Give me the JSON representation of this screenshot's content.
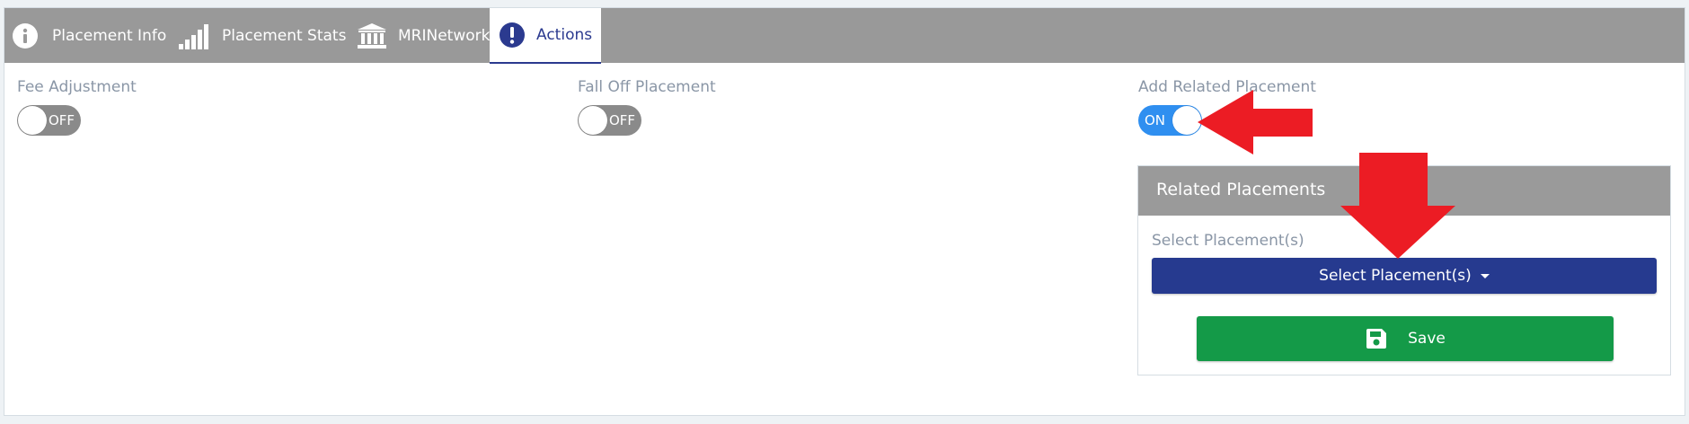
{
  "tabs": [
    {
      "label": "Placement Info",
      "icon": "info-circle-icon",
      "active": false
    },
    {
      "label": "Placement Stats",
      "icon": "signal-bars-icon",
      "active": false
    },
    {
      "label": "MRINetwork",
      "icon": "bank-building-icon",
      "active": false
    },
    {
      "label": "Actions",
      "icon": "exclamation-circle-icon",
      "active": true
    }
  ],
  "fields": {
    "fee_adjustment": {
      "label": "Fee Adjustment",
      "toggle": "OFF"
    },
    "fall_off_placement": {
      "label": "Fall Off Placement",
      "toggle": "OFF"
    },
    "add_related_placement": {
      "label": "Add Related Placement",
      "toggle": "ON"
    }
  },
  "related_placements": {
    "title": "Related Placements",
    "select_label": "Select Placement(s)",
    "select_button": "Select Placement(s)",
    "save_button": "Save"
  },
  "colors": {
    "tabbar": "#999999",
    "active_tab_text": "#2b3a8f",
    "toggle_on": "#2f8ff0",
    "toggle_off": "#8a8a8a",
    "select_button": "#263a8f",
    "save_button": "#149a48",
    "annotation_arrow": "#ec1c24"
  }
}
